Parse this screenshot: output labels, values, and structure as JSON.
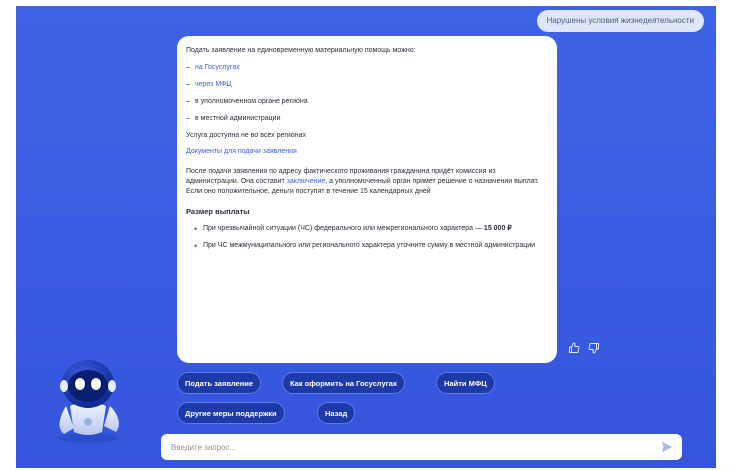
{
  "chat": {
    "user_message": "Нарушены условия жизнедеятельности"
  },
  "bot": {
    "intro": "Подать заявление на единовременную материальную помощь можно:",
    "options": [
      {
        "text": "на Госуслугах",
        "is_link": true
      },
      {
        "text": "через МФЦ",
        "is_link": true
      },
      {
        "text": "в уполномоченном органе региона",
        "is_link": false
      },
      {
        "text": "в местной администрации",
        "is_link": false
      }
    ],
    "availability": "Услуга доступна не во всех регионах",
    "docs_link": "Документы для подачи заявления",
    "after_text_1": "После подачи заявления по адресу фактического проживания гражданина придёт комиссия из администрации. Она составит",
    "after_link": "заключение",
    "after_text_2": ", а уполномоченный орган примет решение о назначении выплат. Если оно положительное, деньги поступят в течение 15 календарных дней",
    "payment_title": "Размер выплаты",
    "payments": [
      {
        "text": "При чрезвычайной ситуации (ЧС) федерального или межрегионального характера —",
        "amount": "15 000 ₽"
      },
      {
        "text": "При ЧС межмуниципального или регионального характера уточните сумму в местной администрации",
        "amount": ""
      }
    ]
  },
  "quick_replies": [
    "Подать заявление",
    "Как оформить на Госуслугах",
    "Найти МФЦ",
    "Другие меры поддержки",
    "Назад"
  ],
  "input": {
    "placeholder": "Введите запрос..."
  },
  "icons": {
    "like": "thumbs-up-icon",
    "dislike": "thumbs-down-icon",
    "send": "send-arrow-icon",
    "assistant": "robot-assistant-icon"
  },
  "colors": {
    "background": "#3a5ce2",
    "link": "#3d5fd9",
    "quick_reply": "#1e3aa8",
    "user_bubble": "#dfe6f7"
  }
}
